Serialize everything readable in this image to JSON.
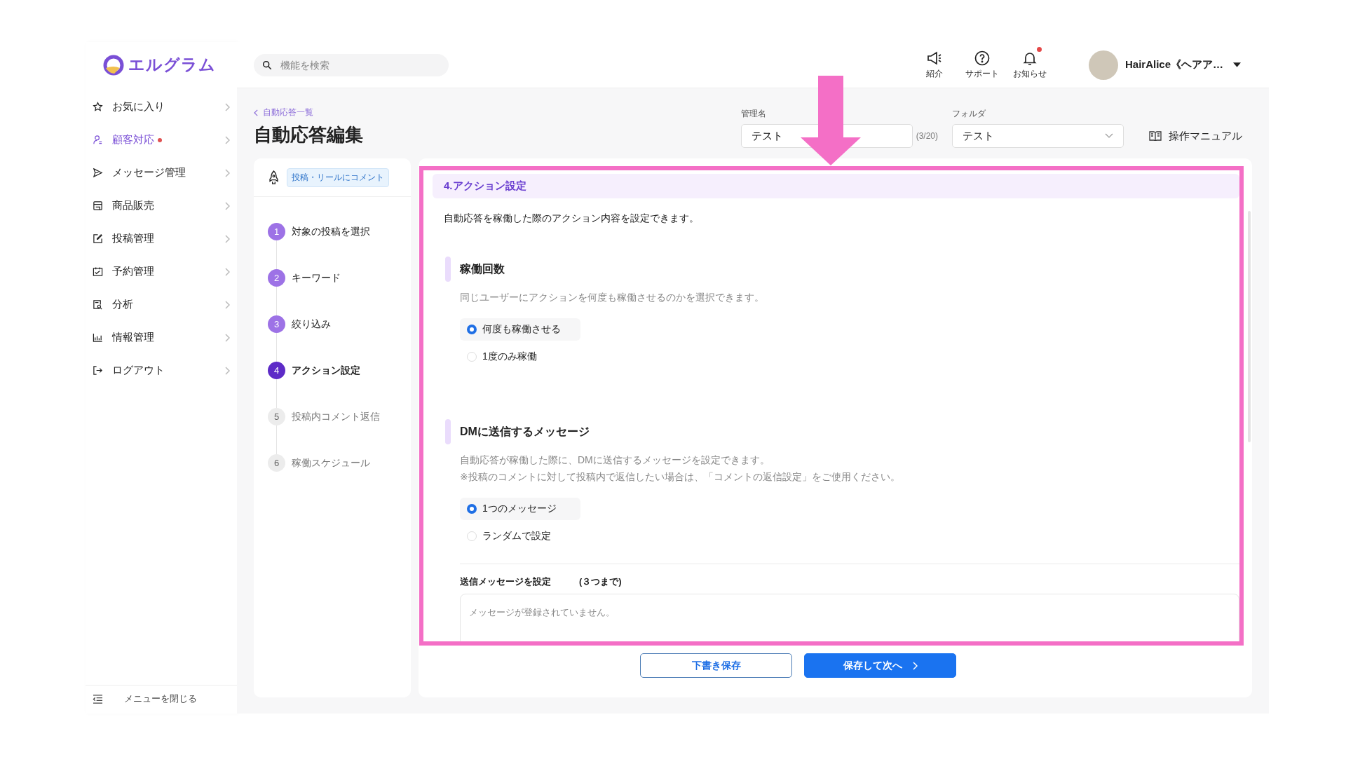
{
  "logo": {
    "text": "エルグラム"
  },
  "search": {
    "placeholder": "機能を検索"
  },
  "header_icons": [
    {
      "kind": "megaphone",
      "label": "紹介",
      "badge": false
    },
    {
      "kind": "help",
      "label": "サポート",
      "badge": false
    },
    {
      "kind": "bell",
      "label": "お知らせ",
      "badge": true
    }
  ],
  "user": {
    "name": "HairAlice《ヘアア…"
  },
  "sidebar": {
    "items": [
      {
        "kind": "star",
        "label": "お気に入り",
        "selected": false,
        "badge": false
      },
      {
        "kind": "person",
        "label": "顧客対応",
        "selected": true,
        "badge": true
      },
      {
        "kind": "send",
        "label": "メッセージ管理",
        "selected": false,
        "badge": false
      },
      {
        "kind": "store",
        "label": "商品販売",
        "selected": false,
        "badge": false
      },
      {
        "kind": "edit",
        "label": "投稿管理",
        "selected": false,
        "badge": false
      },
      {
        "kind": "calendar",
        "label": "予約管理",
        "selected": false,
        "badge": false
      },
      {
        "kind": "report",
        "label": "分析",
        "selected": false,
        "badge": false
      },
      {
        "kind": "chart",
        "label": "情報管理",
        "selected": false,
        "badge": false
      },
      {
        "kind": "logout",
        "label": "ログアウト",
        "selected": false,
        "badge": false
      }
    ],
    "collapse": "メニューを閉じる"
  },
  "breadcrumb": "自動応答一覧",
  "page_title": "自動応答編集",
  "name_field": {
    "label": "管理名",
    "value": "テスト",
    "count": "(3/20)"
  },
  "folder_field": {
    "label": "フォルダ",
    "value": "テスト"
  },
  "manual_link": "操作マニュアル",
  "trigger_tag": "投稿・リールにコメント",
  "steps": [
    {
      "number": "1",
      "label": "対象の投稿を選択",
      "selected": false,
      "completed": true
    },
    {
      "number": "2",
      "label": "キーワード",
      "selected": false,
      "completed": true
    },
    {
      "number": "3",
      "label": "絞り込み",
      "selected": false,
      "completed": true
    },
    {
      "number": "4",
      "label": "アクション設定",
      "selected": true,
      "completed": false
    },
    {
      "number": "5",
      "label": "投稿内コメント返信",
      "selected": false,
      "completed": false
    },
    {
      "number": "6",
      "label": "稼働スケジュール",
      "selected": false,
      "completed": false
    }
  ],
  "section": {
    "title": "4.アクション設定",
    "description": "自動応答を稼働した際のアクション内容を設定できます。"
  },
  "groups": [
    {
      "title": "稼働回数",
      "description": [
        "同じユーザーにアクションを何度も稼働させるのかを選択できます。"
      ],
      "options": [
        {
          "label": "何度も稼働させる",
          "selected": true
        },
        {
          "label": "1度のみ稼働",
          "selected": false
        }
      ]
    },
    {
      "title": "DMに送信するメッセージ",
      "description": [
        "自動応答が稼働した際に、DMに送信するメッセージを設定できます。",
        "※投稿のコメントに対して投稿内で返信したい場合は、「コメントの返信設定」をご使用ください。"
      ],
      "options": [
        {
          "label": "1つのメッセージ",
          "selected": true
        },
        {
          "label": "ランダムで設定",
          "selected": false
        }
      ]
    }
  ],
  "message_list": {
    "title": "送信メッセージを設定",
    "limit": "(３つまで)",
    "empty_text": "メッセージが登録されていません。"
  },
  "buttons": [
    {
      "label": "下書き保存",
      "kind": "secondary",
      "chevron": false
    },
    {
      "label": "保存して次へ",
      "kind": "primary",
      "chevron": true
    }
  ]
}
